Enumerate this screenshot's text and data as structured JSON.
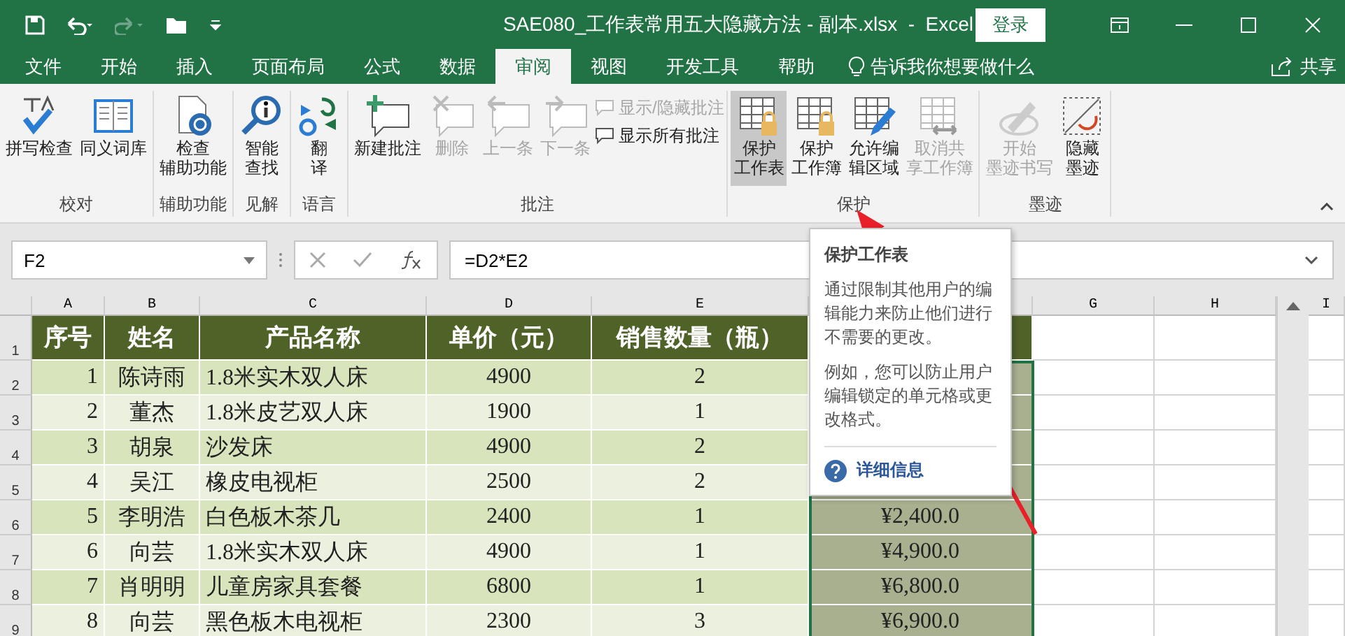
{
  "window": {
    "title": "SAE080_工作表常用五大隐藏方法 - 副本.xlsx  -  Excel",
    "login": "登录"
  },
  "tabs": [
    {
      "label": "文件",
      "selected": false
    },
    {
      "label": "开始",
      "selected": false
    },
    {
      "label": "插入",
      "selected": false
    },
    {
      "label": "页面布局",
      "selected": false
    },
    {
      "label": "公式",
      "selected": false
    },
    {
      "label": "数据",
      "selected": false
    },
    {
      "label": "审阅",
      "selected": true
    },
    {
      "label": "视图",
      "selected": false
    },
    {
      "label": "开发工具",
      "selected": false
    },
    {
      "label": "帮助",
      "selected": false
    }
  ],
  "tell_me": "告诉我你想要做什么",
  "share": "共享",
  "ribbon": [
    {
      "label": "校对",
      "buttons": [
        {
          "label": "拼写检查",
          "disabled": false,
          "selected": false
        },
        {
          "label": "同义词库",
          "disabled": false,
          "selected": false
        }
      ]
    },
    {
      "label": "辅助功能",
      "buttons": [
        {
          "label": "检查辅助功能",
          "disabled": false,
          "selected": false
        }
      ]
    },
    {
      "label": "见解",
      "buttons": [
        {
          "label": "智能查找",
          "disabled": false,
          "selected": false
        }
      ]
    },
    {
      "label": "语言",
      "buttons": [
        {
          "label": "翻译",
          "disabled": false,
          "selected": false
        }
      ]
    },
    {
      "label": "批注",
      "buttons": [
        {
          "label": "新建批注",
          "disabled": false,
          "selected": false
        },
        {
          "label": "删除",
          "disabled": true,
          "selected": false
        },
        {
          "label": "上一条",
          "disabled": true,
          "selected": false
        },
        {
          "label": "下一条",
          "disabled": true,
          "selected": false
        }
      ],
      "small": [
        {
          "label": "显示/隐藏批注",
          "disabled": true
        },
        {
          "label": "显示所有批注",
          "disabled": false
        }
      ]
    },
    {
      "label": "保护",
      "buttons": [
        {
          "label": "保护工作表",
          "disabled": false,
          "selected": true
        },
        {
          "label": "保护工作簿",
          "disabled": false,
          "selected": false
        },
        {
          "label": "允许编辑区域",
          "disabled": false,
          "selected": false
        },
        {
          "label": "取消共享工作簿",
          "disabled": true,
          "selected": false
        }
      ]
    },
    {
      "label": "墨迹",
      "buttons": [
        {
          "label": "开始墨迹书写",
          "disabled": true,
          "selected": false
        },
        {
          "label": "隐藏墨迹",
          "disabled": false,
          "selected": false
        }
      ]
    }
  ],
  "formula_bar": {
    "name_box": "F2",
    "formula": "=D2*E2"
  },
  "columns": [
    "A",
    "B",
    "C",
    "D",
    "E",
    "G",
    "H",
    "I"
  ],
  "header_row": {
    "row": "1",
    "cells": [
      "序号",
      "姓名",
      "产品名称",
      "单价（元）",
      "销售数量（瓶）"
    ]
  },
  "rows": [
    {
      "row": "2",
      "cells": [
        "1",
        "陈诗雨",
        "1.8米实木双人床",
        "4900",
        "2"
      ]
    },
    {
      "row": "3",
      "cells": [
        "2",
        "董杰",
        "1.8米皮艺双人床",
        "1900",
        "1"
      ]
    },
    {
      "row": "4",
      "cells": [
        "3",
        "胡泉",
        "沙发床",
        "4900",
        "2"
      ]
    },
    {
      "row": "5",
      "cells": [
        "4",
        "吴江",
        "橡皮电视柜",
        "2500",
        "2"
      ]
    },
    {
      "row": "6",
      "cells": [
        "5",
        "李明浩",
        "白色板木茶几",
        "2400",
        "1"
      ],
      "total": "¥2,400.0"
    },
    {
      "row": "7",
      "cells": [
        "6",
        "向芸",
        "1.8米实木双人床",
        "4900",
        "1"
      ],
      "total": "¥4,900.0"
    },
    {
      "row": "8",
      "cells": [
        "7",
        "肖明明",
        "儿童房家具套餐",
        "6800",
        "1"
      ],
      "total": "¥6,800.0"
    },
    {
      "row": "9",
      "cells": [
        "8",
        "向芸",
        "黑色板木电视柜",
        "2300",
        "3"
      ],
      "total": "¥6,900.0"
    }
  ],
  "tooltip": {
    "title": "保护工作表",
    "paragraphs": [
      "通过限制其他用户的编辑能力来防止他们进行不需要的更改。",
      "例如，您可以防止用户编辑锁定的单元格或更改格式。"
    ],
    "link": "详细信息"
  }
}
